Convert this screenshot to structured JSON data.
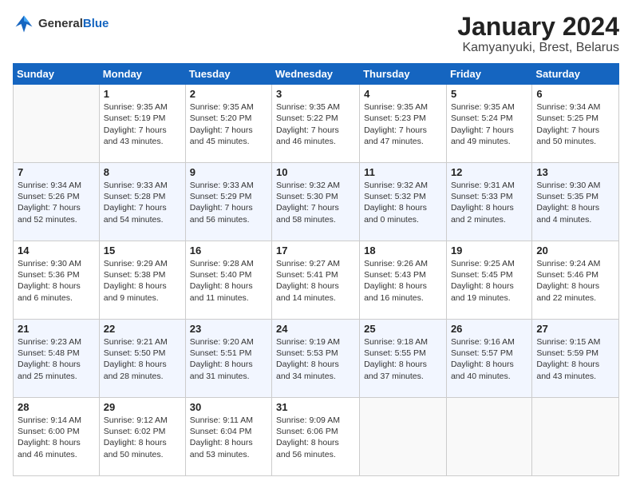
{
  "logo": {
    "general": "General",
    "blue": "Blue"
  },
  "title": "January 2024",
  "subtitle": "Kamyanyuki, Brest, Belarus",
  "days_of_week": [
    "Sunday",
    "Monday",
    "Tuesday",
    "Wednesday",
    "Thursday",
    "Friday",
    "Saturday"
  ],
  "weeks": [
    [
      {
        "day": "",
        "sunrise": "",
        "sunset": "",
        "daylight": ""
      },
      {
        "day": "1",
        "sunrise": "Sunrise: 9:35 AM",
        "sunset": "Sunset: 5:19 PM",
        "daylight": "Daylight: 7 hours and 43 minutes."
      },
      {
        "day": "2",
        "sunrise": "Sunrise: 9:35 AM",
        "sunset": "Sunset: 5:20 PM",
        "daylight": "Daylight: 7 hours and 45 minutes."
      },
      {
        "day": "3",
        "sunrise": "Sunrise: 9:35 AM",
        "sunset": "Sunset: 5:22 PM",
        "daylight": "Daylight: 7 hours and 46 minutes."
      },
      {
        "day": "4",
        "sunrise": "Sunrise: 9:35 AM",
        "sunset": "Sunset: 5:23 PM",
        "daylight": "Daylight: 7 hours and 47 minutes."
      },
      {
        "day": "5",
        "sunrise": "Sunrise: 9:35 AM",
        "sunset": "Sunset: 5:24 PM",
        "daylight": "Daylight: 7 hours and 49 minutes."
      },
      {
        "day": "6",
        "sunrise": "Sunrise: 9:34 AM",
        "sunset": "Sunset: 5:25 PM",
        "daylight": "Daylight: 7 hours and 50 minutes."
      }
    ],
    [
      {
        "day": "7",
        "sunrise": "Sunrise: 9:34 AM",
        "sunset": "Sunset: 5:26 PM",
        "daylight": "Daylight: 7 hours and 52 minutes."
      },
      {
        "day": "8",
        "sunrise": "Sunrise: 9:33 AM",
        "sunset": "Sunset: 5:28 PM",
        "daylight": "Daylight: 7 hours and 54 minutes."
      },
      {
        "day": "9",
        "sunrise": "Sunrise: 9:33 AM",
        "sunset": "Sunset: 5:29 PM",
        "daylight": "Daylight: 7 hours and 56 minutes."
      },
      {
        "day": "10",
        "sunrise": "Sunrise: 9:32 AM",
        "sunset": "Sunset: 5:30 PM",
        "daylight": "Daylight: 7 hours and 58 minutes."
      },
      {
        "day": "11",
        "sunrise": "Sunrise: 9:32 AM",
        "sunset": "Sunset: 5:32 PM",
        "daylight": "Daylight: 8 hours and 0 minutes."
      },
      {
        "day": "12",
        "sunrise": "Sunrise: 9:31 AM",
        "sunset": "Sunset: 5:33 PM",
        "daylight": "Daylight: 8 hours and 2 minutes."
      },
      {
        "day": "13",
        "sunrise": "Sunrise: 9:30 AM",
        "sunset": "Sunset: 5:35 PM",
        "daylight": "Daylight: 8 hours and 4 minutes."
      }
    ],
    [
      {
        "day": "14",
        "sunrise": "Sunrise: 9:30 AM",
        "sunset": "Sunset: 5:36 PM",
        "daylight": "Daylight: 8 hours and 6 minutes."
      },
      {
        "day": "15",
        "sunrise": "Sunrise: 9:29 AM",
        "sunset": "Sunset: 5:38 PM",
        "daylight": "Daylight: 8 hours and 9 minutes."
      },
      {
        "day": "16",
        "sunrise": "Sunrise: 9:28 AM",
        "sunset": "Sunset: 5:40 PM",
        "daylight": "Daylight: 8 hours and 11 minutes."
      },
      {
        "day": "17",
        "sunrise": "Sunrise: 9:27 AM",
        "sunset": "Sunset: 5:41 PM",
        "daylight": "Daylight: 8 hours and 14 minutes."
      },
      {
        "day": "18",
        "sunrise": "Sunrise: 9:26 AM",
        "sunset": "Sunset: 5:43 PM",
        "daylight": "Daylight: 8 hours and 16 minutes."
      },
      {
        "day": "19",
        "sunrise": "Sunrise: 9:25 AM",
        "sunset": "Sunset: 5:45 PM",
        "daylight": "Daylight: 8 hours and 19 minutes."
      },
      {
        "day": "20",
        "sunrise": "Sunrise: 9:24 AM",
        "sunset": "Sunset: 5:46 PM",
        "daylight": "Daylight: 8 hours and 22 minutes."
      }
    ],
    [
      {
        "day": "21",
        "sunrise": "Sunrise: 9:23 AM",
        "sunset": "Sunset: 5:48 PM",
        "daylight": "Daylight: 8 hours and 25 minutes."
      },
      {
        "day": "22",
        "sunrise": "Sunrise: 9:21 AM",
        "sunset": "Sunset: 5:50 PM",
        "daylight": "Daylight: 8 hours and 28 minutes."
      },
      {
        "day": "23",
        "sunrise": "Sunrise: 9:20 AM",
        "sunset": "Sunset: 5:51 PM",
        "daylight": "Daylight: 8 hours and 31 minutes."
      },
      {
        "day": "24",
        "sunrise": "Sunrise: 9:19 AM",
        "sunset": "Sunset: 5:53 PM",
        "daylight": "Daylight: 8 hours and 34 minutes."
      },
      {
        "day": "25",
        "sunrise": "Sunrise: 9:18 AM",
        "sunset": "Sunset: 5:55 PM",
        "daylight": "Daylight: 8 hours and 37 minutes."
      },
      {
        "day": "26",
        "sunrise": "Sunrise: 9:16 AM",
        "sunset": "Sunset: 5:57 PM",
        "daylight": "Daylight: 8 hours and 40 minutes."
      },
      {
        "day": "27",
        "sunrise": "Sunrise: 9:15 AM",
        "sunset": "Sunset: 5:59 PM",
        "daylight": "Daylight: 8 hours and 43 minutes."
      }
    ],
    [
      {
        "day": "28",
        "sunrise": "Sunrise: 9:14 AM",
        "sunset": "Sunset: 6:00 PM",
        "daylight": "Daylight: 8 hours and 46 minutes."
      },
      {
        "day": "29",
        "sunrise": "Sunrise: 9:12 AM",
        "sunset": "Sunset: 6:02 PM",
        "daylight": "Daylight: 8 hours and 50 minutes."
      },
      {
        "day": "30",
        "sunrise": "Sunrise: 9:11 AM",
        "sunset": "Sunset: 6:04 PM",
        "daylight": "Daylight: 8 hours and 53 minutes."
      },
      {
        "day": "31",
        "sunrise": "Sunrise: 9:09 AM",
        "sunset": "Sunset: 6:06 PM",
        "daylight": "Daylight: 8 hours and 56 minutes."
      },
      {
        "day": "",
        "sunrise": "",
        "sunset": "",
        "daylight": ""
      },
      {
        "day": "",
        "sunrise": "",
        "sunset": "",
        "daylight": ""
      },
      {
        "day": "",
        "sunrise": "",
        "sunset": "",
        "daylight": ""
      }
    ]
  ]
}
